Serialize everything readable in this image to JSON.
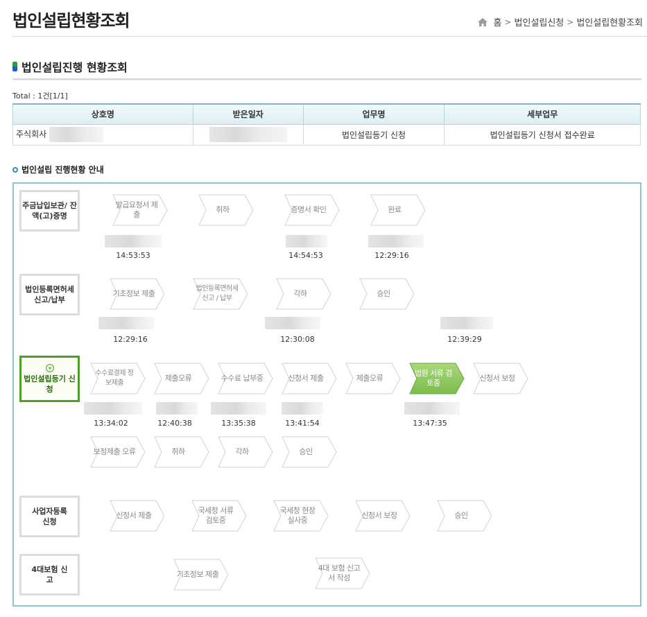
{
  "header": {
    "title": "법인설립현황조회",
    "breadcrumb": [
      "홈",
      "법인설립신청",
      "법인설립현황조회"
    ]
  },
  "section": {
    "title": "법인설립진행 현황조회",
    "total": "Total : 1건[1/1]"
  },
  "table": {
    "columns": [
      "상호명",
      "받은일자",
      "업무명",
      "세부업무"
    ],
    "rows": [
      {
        "name": "주식회사",
        "date": "",
        "task": "법인설립등기 신청",
        "detail": "법인설립등기 신청서 접수완료"
      }
    ]
  },
  "guide": {
    "title": "법인설립 진행현황 안내",
    "categories": [
      {
        "label": "주금납입보관/ 잔액(고)증명",
        "active": false
      },
      {
        "label": "법인등록면허세 신고/납부",
        "active": false
      },
      {
        "label": "법인설립등기 신청",
        "active": true
      },
      {
        "label": "사업자등록 신청",
        "active": false
      },
      {
        "label": "4대보험 신고",
        "active": false
      }
    ],
    "row1_steps": [
      "발급요청서 제출",
      "취하",
      "증명서 확인",
      "완료"
    ],
    "row1_times": [
      "14:53:53",
      "14:54:53",
      "12:29:16"
    ],
    "row2_steps": [
      "기초정보 제출",
      "법인등록면허세 신고 / 납부",
      "각하",
      "승인"
    ],
    "row2_times": [
      "12:29:16",
      "12:30:08",
      "12:39:29"
    ],
    "row3_steps": [
      "수수료결제 정보제출",
      "제출오류",
      "수수료 납부중",
      "신청서 제출",
      "제출오류",
      "법원 서류 검토중",
      "신청서 보정"
    ],
    "row3_times": [
      "13:34:02",
      "12:40:38",
      "13:35:38",
      "13:41:54",
      "13:47:35"
    ],
    "row3b_steps": [
      "보정제출 오류",
      "취하",
      "각하",
      "승인"
    ],
    "row4_steps": [
      "신청서 제출",
      "국세청 서류 검토중",
      "국세청 현장 실사중",
      "신청서 보정",
      "승인"
    ],
    "row5_steps": [
      "기초정보 제출",
      "4대 보험 신고서 작성"
    ],
    "active_step": "법원 서류 검토중"
  },
  "colors": {
    "board_border": "#8ec3d3",
    "active_category": "#4f9e2a",
    "active_step": "#8cc85f"
  }
}
